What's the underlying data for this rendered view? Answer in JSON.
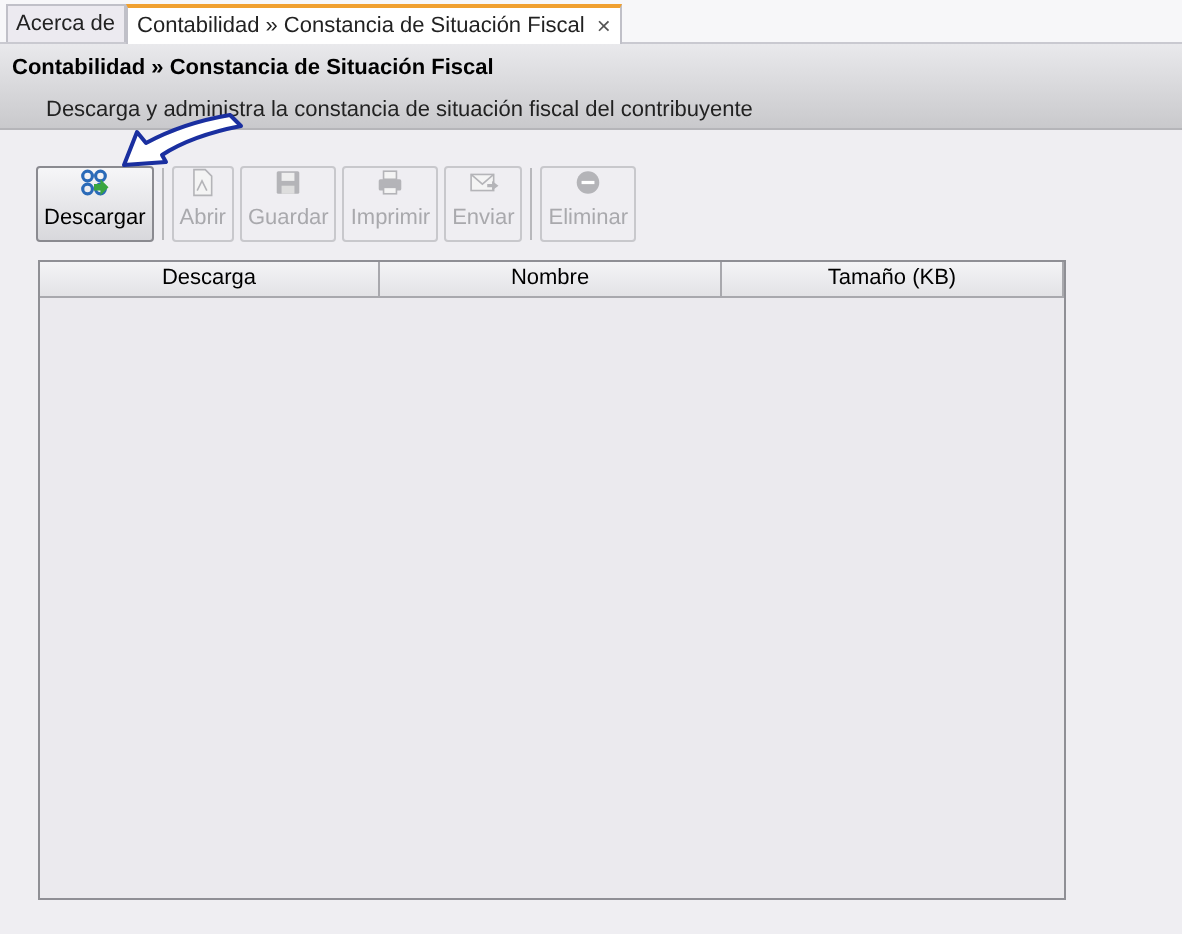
{
  "tabs": [
    {
      "label": "Acerca de",
      "selected": false
    },
    {
      "label": "Contabilidad » Constancia de Situación Fiscal",
      "selected": true,
      "close": "×"
    }
  ],
  "header": {
    "title": "Contabilidad » Constancia de Situación Fiscal",
    "subtitle": "Descarga y administra la constancia de situación fiscal del contribuyente"
  },
  "toolbar": [
    {
      "kind": "button",
      "label": "Descargar",
      "disabled": false
    },
    {
      "kind": "separator"
    },
    {
      "kind": "button",
      "label": "Abrir",
      "disabled": true
    },
    {
      "kind": "button",
      "label": "Guardar",
      "disabled": true
    },
    {
      "kind": "button",
      "label": "Imprimir",
      "disabled": true
    },
    {
      "kind": "button",
      "label": "Enviar",
      "disabled": true
    },
    {
      "kind": "separator"
    },
    {
      "kind": "button",
      "label": "Eliminar",
      "disabled": true
    }
  ],
  "table": {
    "columns": [
      "Descarga",
      "Nombre",
      "Tamaño (KB)"
    ]
  }
}
